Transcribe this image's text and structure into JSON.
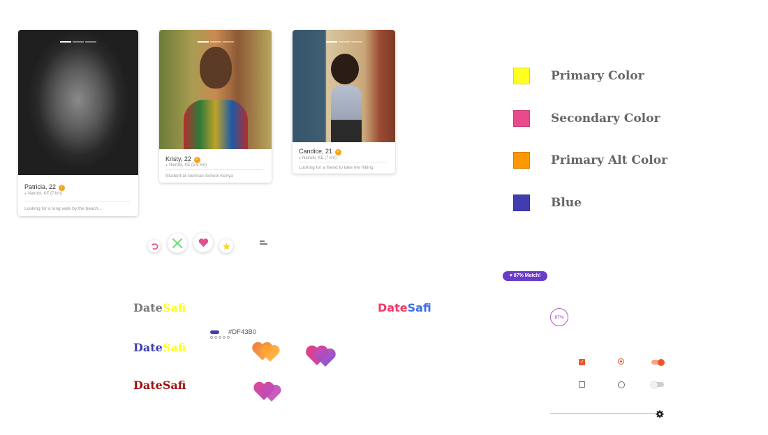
{
  "cards": [
    {
      "name": "Patricia, 22",
      "location": "Nairobi, KE (7 km)",
      "bio": "Looking for a long walk by the beach..."
    },
    {
      "name": "Kristy, 22",
      "location": "Nairobi, KE (5.6 km)",
      "bio": "Student at German School Kenya"
    },
    {
      "name": "Candice, 21",
      "location": "Nairobi, KE (7 km)",
      "bio": "Looking for a friend to take me hiking"
    }
  ],
  "actions": {
    "undo_icon": "undo-icon",
    "reject_icon": "close-icon",
    "like_icon": "heart-icon",
    "superlike_icon": "star-icon",
    "menu_icon": "menu-icon"
  },
  "palette": [
    {
      "label": "Primary Color",
      "color": "#ffff22"
    },
    {
      "label": "Secondary Color",
      "color": "#e84a8c"
    },
    {
      "label": "Primary Alt Color",
      "color": "#ff9800"
    },
    {
      "label": "Blue",
      "color": "#3f3db0"
    }
  ],
  "brand": {
    "date": "Date",
    "safi": "Safi",
    "hex": "#DF43B0"
  },
  "match": {
    "badge": "87% Match!",
    "percent": "87%"
  },
  "controls": {
    "checkbox_checked": true,
    "radio_checked": true,
    "toggle_on": true,
    "slider_value": 1.0
  }
}
